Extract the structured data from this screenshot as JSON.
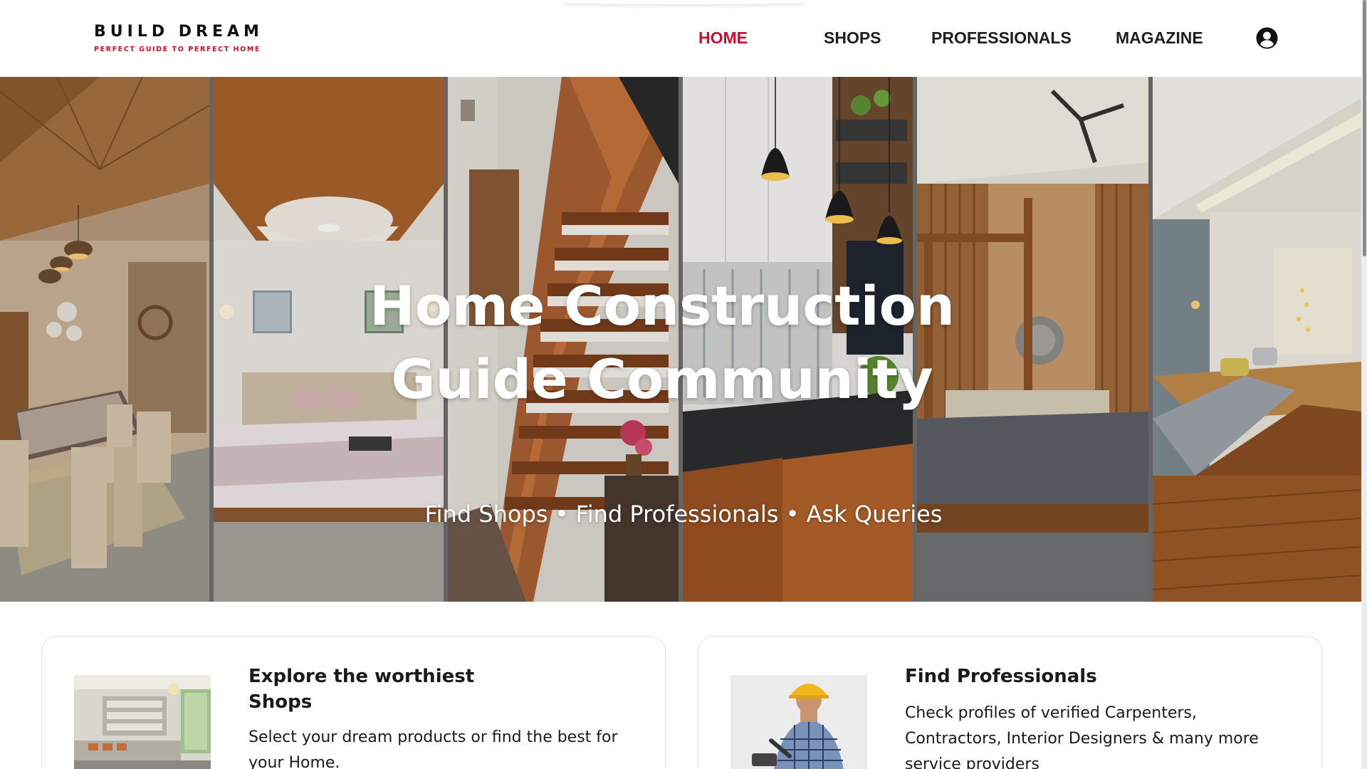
{
  "brand": {
    "name": "BUILD DREAM",
    "tagline": "PERFECT GUIDE TO PERFECT HOME",
    "accent_color": "#c8102e"
  },
  "nav": {
    "home": "HOME",
    "shops": "SHOPS",
    "professionals": "PROFESSIONALS",
    "magazine": "MAGAZINE",
    "active": "home",
    "account_icon": "user-circle-icon"
  },
  "hero": {
    "title": "Home Construction Guide Community",
    "subtitle": "Find Shops • Find Professionals • Ask Queries",
    "panels": [
      "dining-room",
      "bedroom",
      "staircase",
      "kitchen",
      "canopy-bedroom",
      "living-room"
    ]
  },
  "cards": {
    "shops": {
      "title": "Explore the worthiest Shops",
      "text": "Select your dream products or find the best for your Home.",
      "image": "living-room-photo"
    },
    "professionals": {
      "title": "Find Professionals",
      "text": "Check profiles of verified Carpenters, Contractors, Interior Designers & many more service providers",
      "image": "construction-worker-photo"
    }
  }
}
